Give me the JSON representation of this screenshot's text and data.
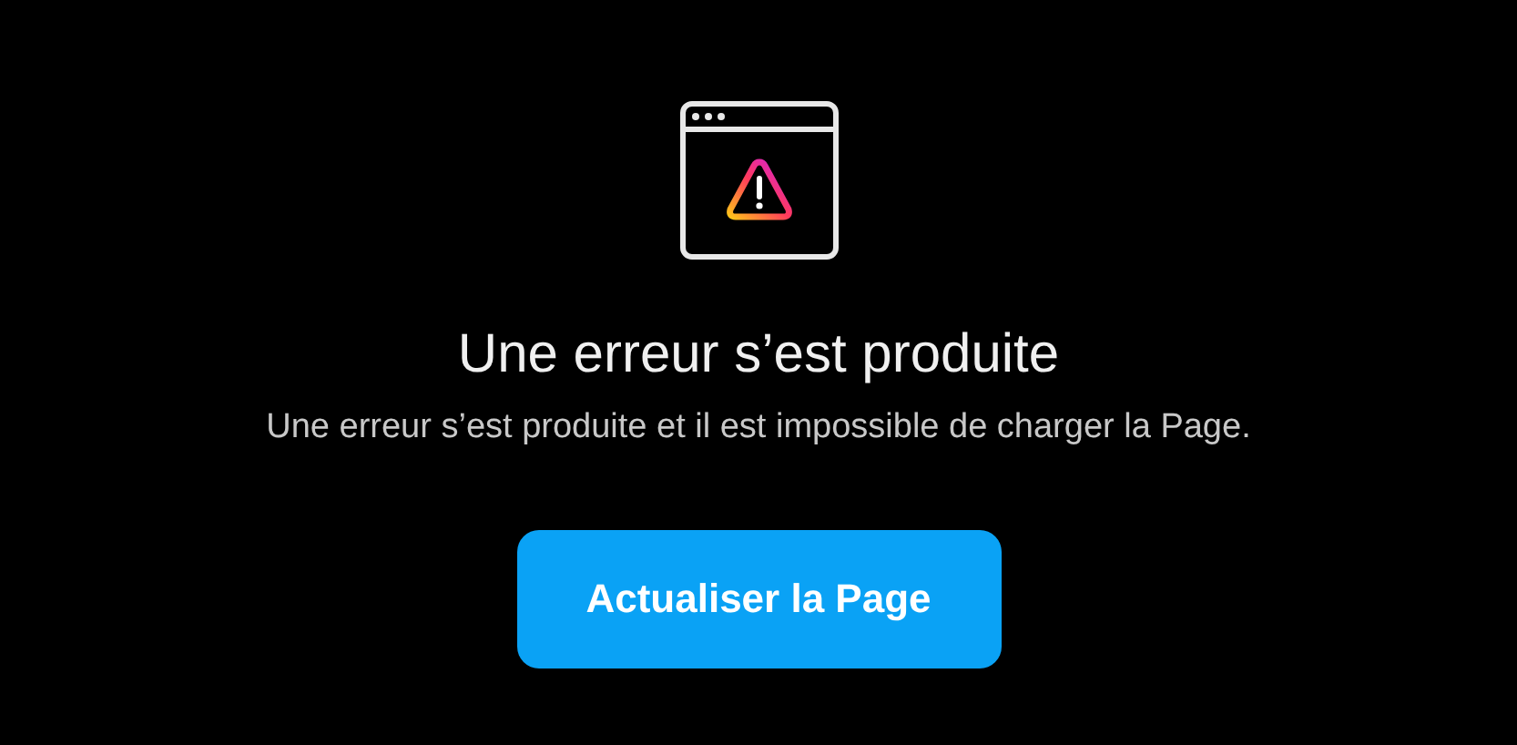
{
  "error": {
    "title": "Une erreur s’est produite",
    "message": "Une erreur s’est produite et il est impossible de charger la Page.",
    "button": "Actualiser la Page"
  }
}
